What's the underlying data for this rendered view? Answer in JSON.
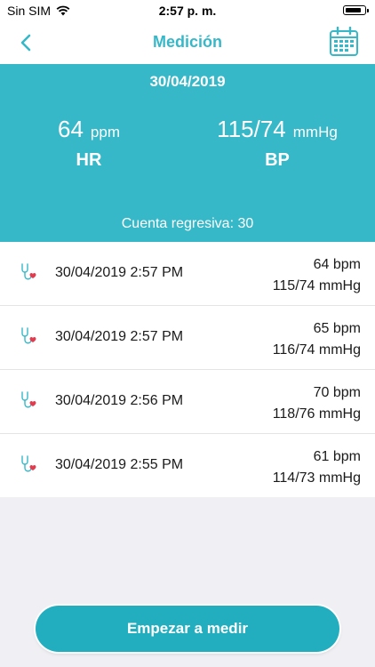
{
  "status_bar": {
    "carrier": "Sin SIM",
    "time": "2:57 p. m."
  },
  "nav": {
    "title": "Medición"
  },
  "summary": {
    "date": "30/04/2019",
    "hr": {
      "value": "64",
      "unit": "ppm",
      "label": "HR"
    },
    "bp": {
      "value": "115/74",
      "unit": "mmHg",
      "label": "BP"
    },
    "countdown": "Cuenta regresiva: 30"
  },
  "measurements": [
    {
      "datetime": "30/04/2019 2:57 PM",
      "hr": "64 bpm",
      "bp": "115/74 mmHg"
    },
    {
      "datetime": "30/04/2019 2:57 PM",
      "hr": "65 bpm",
      "bp": "116/74 mmHg"
    },
    {
      "datetime": "30/04/2019 2:56 PM",
      "hr": "70 bpm",
      "bp": "118/76 mmHg"
    },
    {
      "datetime": "30/04/2019 2:55 PM",
      "hr": "61 bpm",
      "bp": "114/73 mmHg"
    }
  ],
  "start_button": {
    "label": "Empezar a medir"
  },
  "colors": {
    "accent": "#36b8c8",
    "button": "#23aebf",
    "heart": "#e23b4e"
  }
}
